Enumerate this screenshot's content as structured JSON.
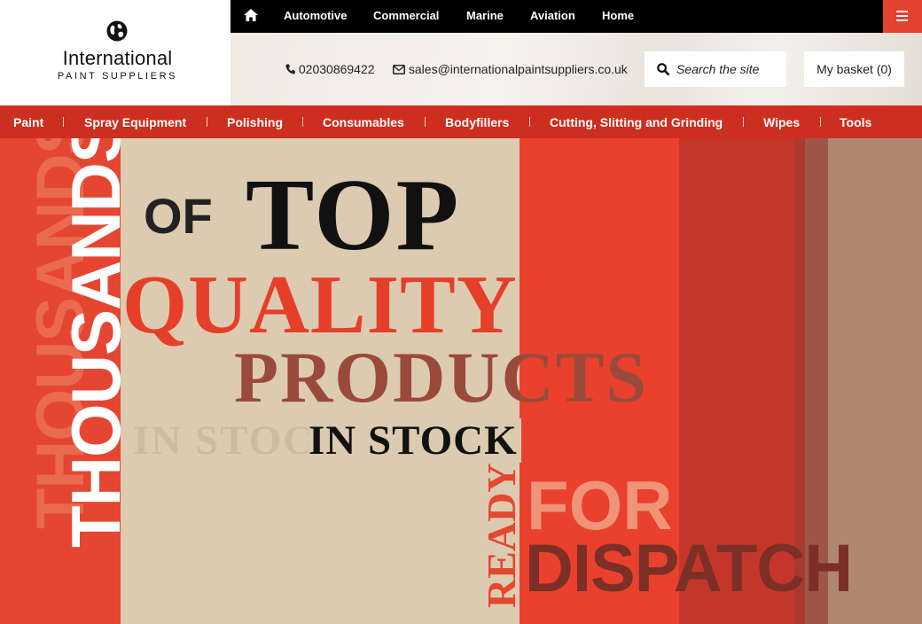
{
  "logo": {
    "line1": "International",
    "line2": "PAINT SUPPLIERS",
    "icon": "globe-icon"
  },
  "top_nav": {
    "home_icon": "home-icon",
    "items": [
      "Automotive",
      "Commercial",
      "Marine",
      "Aviation",
      "Home"
    ],
    "menu_icon": "hamburger-menu-icon"
  },
  "contact": {
    "phone": "02030869422",
    "email": "sales@internationalpaintsuppliers.co.uk"
  },
  "search": {
    "placeholder": "Search the site",
    "value": ""
  },
  "basket": {
    "label": "My basket (0)"
  },
  "categories": [
    "Paint",
    "Spray Equipment",
    "Polishing",
    "Consumables",
    "Bodyfillers",
    "Cutting, Slitting and Grinding",
    "Wipes",
    "Tools"
  ],
  "hero": {
    "thousands": "THOUSANDS",
    "of": "OF",
    "top": "TOP",
    "quality": "QUALITY",
    "products": "PRODUCTS",
    "in_stock": "IN STOCK",
    "ready": "READY",
    "for": "FOR",
    "dispatch": "DISPATCH"
  },
  "colors": {
    "brand_red": "#e3422e",
    "category_bar": "#cc2f1f",
    "beige": "#dcccb1"
  }
}
